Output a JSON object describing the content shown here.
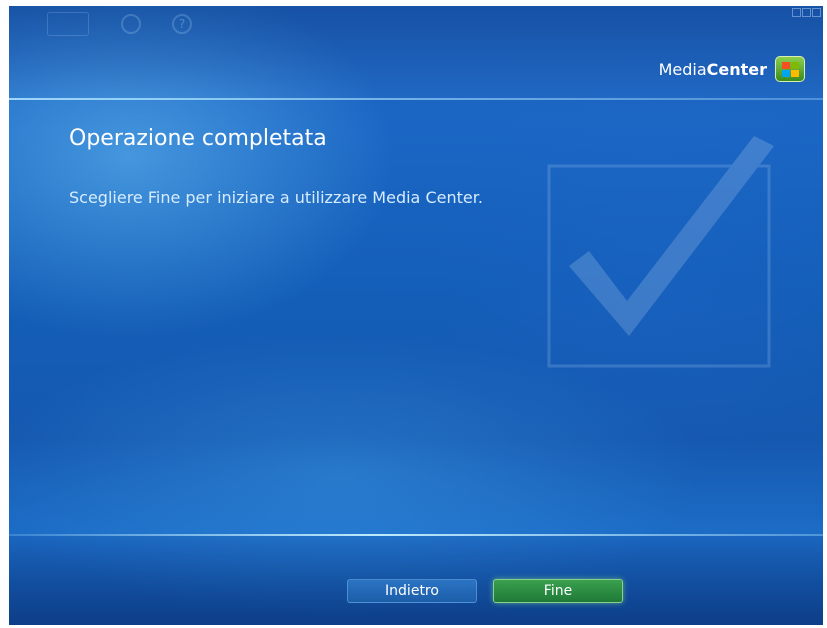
{
  "brand": {
    "name_regular": "Media",
    "name_bold": "Center"
  },
  "main": {
    "title": "Operazione completata",
    "subtitle": "Scegliere Fine per iniziare a utilizzare Media Center."
  },
  "buttons": {
    "back_label": "Indietro",
    "finish_label": "Fine"
  },
  "titlebar": {
    "help_glyph": "?"
  },
  "colors": {
    "background": "#1b66c4",
    "finish_button": "#2a8c41",
    "back_button": "#236ab8",
    "text": "#ffffff"
  },
  "icons": [
    "back-icon",
    "globe-icon",
    "help-icon",
    "media-center-logo-icon",
    "checkmark-icon"
  ]
}
